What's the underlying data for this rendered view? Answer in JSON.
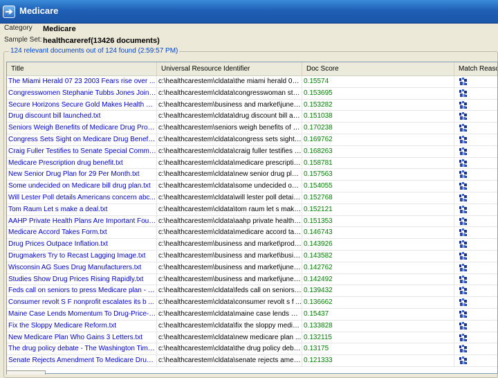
{
  "window": {
    "title": "Medicare",
    "icon": "arrow-right-icon"
  },
  "info": {
    "category_label": "Category",
    "category_value": "Medicare",
    "sample_set_label": "Sample Set:",
    "sample_set_value": "healthcareref(13426 documents)",
    "results_summary": "124 relevant documents out of 124 found (2:59:57 PM)"
  },
  "table": {
    "columns": [
      "Title",
      "Universal Resource Identifier",
      "Doc Score",
      "Match Reason"
    ],
    "match_icon": "match-reason-icon",
    "rows": [
      {
        "title": "The Miami Herald 07 23 2003 Fears rise over ...",
        "uri": "c:\\healthcarestem\\cldata\\the miami herald 07 ...",
        "score": "0.15574"
      },
      {
        "title": "Congresswomen Stephanie Tubbs Jones Joins ...",
        "uri": "c:\\healthcarestem\\cldata\\congresswoman ste...",
        "score": "0.153695"
      },
      {
        "title": "Secure Horizons Secure Gold Makes Health Car...",
        "uri": "c:\\healthcarestem\\business and market\\june6's ...",
        "score": "0.153282"
      },
      {
        "title": "Drug discount bill launched.txt",
        "uri": "c:\\healthcarestem\\cldata\\drug discount bill au...",
        "score": "0.151038"
      },
      {
        "title": "Seniors Weigh Benefits of Medicare Drug Provi...",
        "uri": "c:\\healthcarestem\\seniors weigh benefits of me...",
        "score": "0.170238"
      },
      {
        "title": "Congress Sets Sight on Medicare Drug Benefit.txt",
        "uri": "c:\\healthcarestem\\cldata\\congress sets sight ...",
        "score": "0.169762"
      },
      {
        "title": "Craig Fuller Testifies to Senate Special Committe...",
        "uri": "c:\\healthcarestem\\cldata\\craig fuller testifies to senate...",
        "score": "0.168263"
      },
      {
        "title": "Medicare Prescription drug benefit.txt",
        "uri": "c:\\healthcarestem\\cldata\\medicare prescriptio...",
        "score": "0.158781"
      },
      {
        "title": "New Senior Drug Plan for 29 Per Month.txt",
        "uri": "c:\\healthcarestem\\cldata\\new senior drug plan ...",
        "score": "0.157563"
      },
      {
        "title": "Some undecided on Medicare bill drug plan.txt",
        "uri": "c:\\healthcarestem\\cldata\\some undecided on ...",
        "score": "0.154055"
      },
      {
        "title": "Will Lester Poll details Americans concern abc...",
        "uri": "c:\\healthcarestem\\cldata\\will lester poll details...",
        "score": "0.152768"
      },
      {
        "title": "Tom Raum Let s make a deal.txt",
        "uri": "c:\\healthcarestem\\cldata\\tom raum let s make ...",
        "score": "0.152121"
      },
      {
        "title": "AAHP Private Health Plans Are Important Found...",
        "uri": "c:\\healthcarestem\\cldata\\aahp private health ...",
        "score": "0.151353"
      },
      {
        "title": "Medicare Accord Takes Form.txt",
        "uri": "c:\\healthcarestem\\cldata\\medicare accord tak...",
        "score": "0.146743"
      },
      {
        "title": "Drug Prices Outpace Inflation.txt",
        "uri": "c:\\healthcarestem\\business and market\\product...",
        "score": "0.143926"
      },
      {
        "title": "Drugmakers Try to Recast Lagging Image.txt",
        "uri": "c:\\healthcarestem\\business and market\\busines...",
        "score": "0.143582"
      },
      {
        "title": "Wisconsin AG Sues Drug Manufacturers.txt",
        "uri": "c:\\healthcarestem\\business and market\\june6's ...",
        "score": "0.142762"
      },
      {
        "title": "Studies Show Drug Prices Rising Rapidly.txt",
        "uri": "c:\\healthcarestem\\business and market\\june6's f...",
        "score": "0.142492"
      },
      {
        "title": "Feds call on seniors to press Medicare plan - 0 ...",
        "uri": "c:\\healthcarestem\\cldata\\feds call on seniors t...",
        "score": "0.139432"
      },
      {
        "title": "Consumer revolt S F nonprofit escalates its b ...",
        "uri": "c:\\healthcarestem\\cldata\\consumer revolt s f ...",
        "score": "0.136662"
      },
      {
        "title": "Maine Case Lends Momentum To Drug-Price-Co ...",
        "uri": "c:\\healthcarestem\\cldata\\maine case lends mo...",
        "score": "0.15437"
      },
      {
        "title": "Fix the Sloppy Medicare Reform.txt",
        "uri": "c:\\healthcarestem\\cldata\\fix the sloppy medicare refor...",
        "score": "0.133828"
      },
      {
        "title": "New Medicare Plan Who Gains 3 Letters.txt",
        "uri": "c:\\healthcarestem\\cldata\\new medicare plan ...",
        "score": "0.132115"
      },
      {
        "title": "The drug policy debate - The Washington Times...",
        "uri": "c:\\healthcarestem\\cldata\\the drug policy debate...",
        "score": "0.13175"
      },
      {
        "title": "Senate Rejects Amendment To Medicare Drug B...",
        "uri": "c:\\healthcarestem\\cldata\\senate rejects amen...",
        "score": "0.121333"
      }
    ]
  }
}
